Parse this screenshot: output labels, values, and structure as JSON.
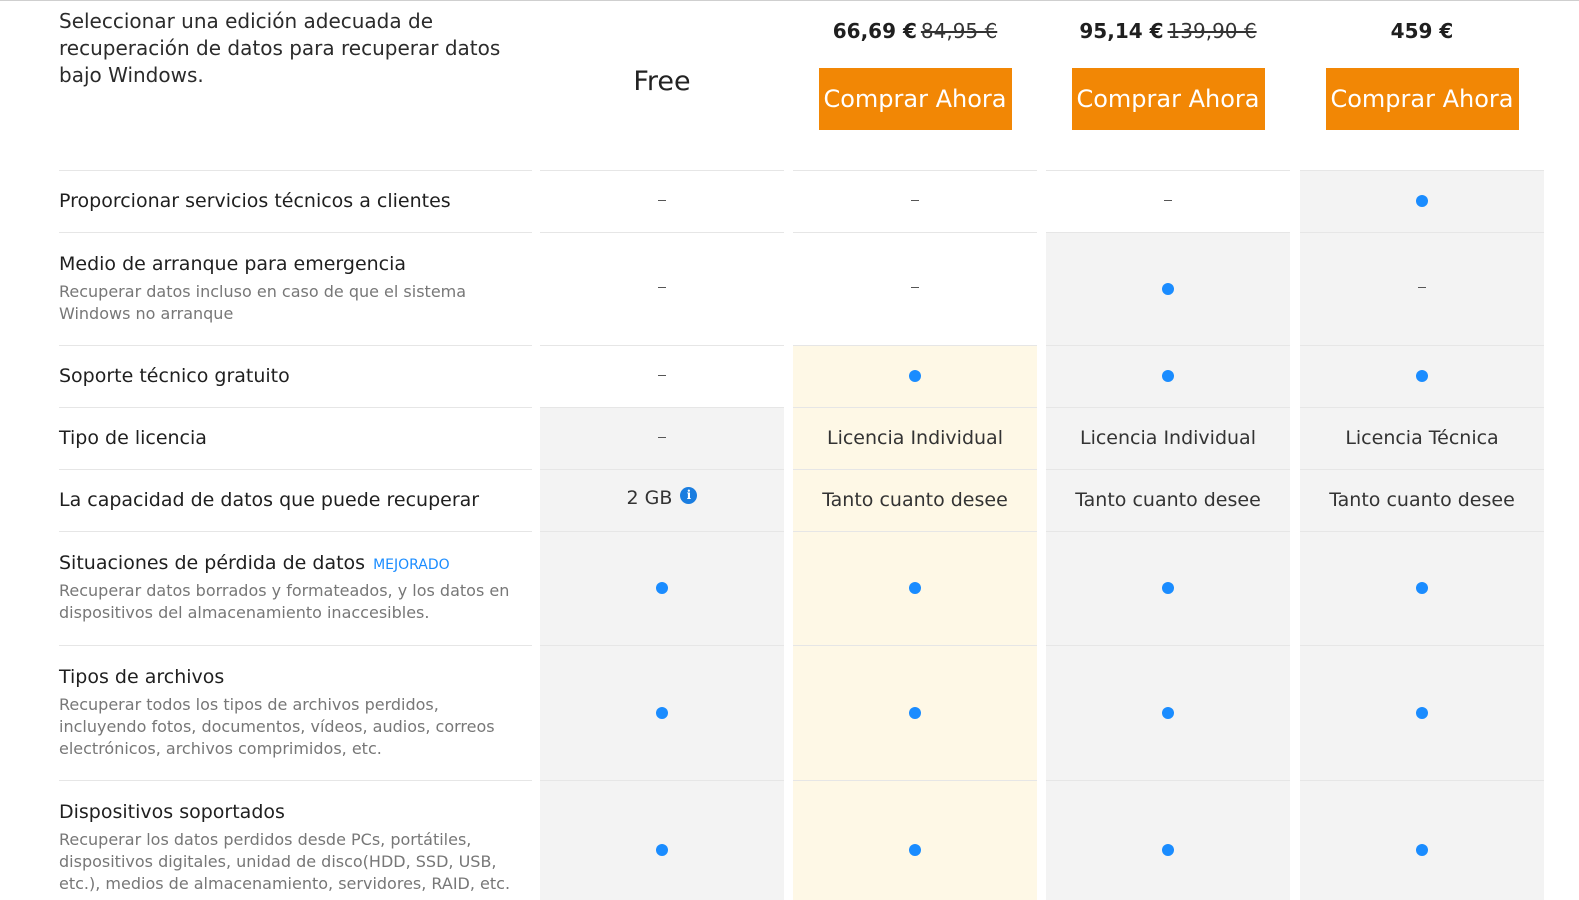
{
  "header": {
    "intro": "Seleccionar una edición adecuada de recuperación de datos para recuperar datos bajo Windows.",
    "free_label": "Free",
    "plans": [
      {
        "price": "66,69 €",
        "old_price": "84,95 €",
        "button": "Comprar Ahora"
      },
      {
        "price": "95,14 €",
        "old_price": "139,90 €",
        "button": "Comprar Ahora"
      },
      {
        "price": "459 €",
        "old_price": "",
        "button": "Comprar Ahora"
      }
    ]
  },
  "colors": {
    "accent_button": "#f28705",
    "dot": "#1a8cff",
    "highlight_column": "#fef8e6",
    "gray_cell": "#f3f3f3"
  },
  "rows": [
    {
      "title": "Proporcionar servicios técnicos a clientes",
      "desc": "",
      "badge": "",
      "cells": [
        {
          "type": "dash"
        },
        {
          "type": "dash"
        },
        {
          "type": "dash"
        },
        {
          "type": "dot"
        }
      ]
    },
    {
      "title": "Medio de arranque para emergencia",
      "desc": "Recuperar datos incluso en caso de que el sistema Windows no arranque",
      "badge": "",
      "cells": [
        {
          "type": "dash"
        },
        {
          "type": "dash"
        },
        {
          "type": "dot"
        },
        {
          "type": "dash"
        }
      ]
    },
    {
      "title": "Soporte técnico gratuito",
      "desc": "",
      "badge": "",
      "cells": [
        {
          "type": "dash"
        },
        {
          "type": "dot"
        },
        {
          "type": "dot"
        },
        {
          "type": "dot"
        }
      ]
    },
    {
      "title": "Tipo de licencia",
      "desc": "",
      "badge": "",
      "cells": [
        {
          "type": "dash"
        },
        {
          "type": "text",
          "text": "Licencia Individual"
        },
        {
          "type": "text",
          "text": "Licencia Individual"
        },
        {
          "type": "text",
          "text": "Licencia Técnica"
        }
      ]
    },
    {
      "title": "La capacidad de datos que puede recuperar",
      "desc": "",
      "badge": "",
      "cells": [
        {
          "type": "text",
          "text": "2 GB",
          "info": "i"
        },
        {
          "type": "text",
          "text": "Tanto cuanto desee"
        },
        {
          "type": "text",
          "text": "Tanto cuanto desee"
        },
        {
          "type": "text",
          "text": "Tanto cuanto desee"
        }
      ]
    },
    {
      "title": "Situaciones de pérdida de datos",
      "desc": "Recuperar datos borrados y formateados, y los datos en dispositivos del almacenamiento inaccesibles.",
      "badge": "MEJORADO",
      "cells": [
        {
          "type": "dot"
        },
        {
          "type": "dot"
        },
        {
          "type": "dot"
        },
        {
          "type": "dot"
        }
      ]
    },
    {
      "title": "Tipos de archivos",
      "desc": "Recuperar todos los tipos de archivos perdidos, incluyendo fotos, documentos, vídeos, audios, correos electrónicos, archivos comprimidos, etc.",
      "badge": "",
      "cells": [
        {
          "type": "dot"
        },
        {
          "type": "dot"
        },
        {
          "type": "dot"
        },
        {
          "type": "dot"
        }
      ]
    },
    {
      "title": "Dispositivos soportados",
      "desc": "Recuperar los datos perdidos desde PCs, portátiles, dispositivos digitales, unidad de disco(HDD, SSD, USB, etc.), medios de almacenamiento, servidores, RAID, etc.",
      "badge": "",
      "cells": [
        {
          "type": "dot"
        },
        {
          "type": "dot"
        },
        {
          "type": "dot"
        },
        {
          "type": "dot"
        }
      ]
    }
  ]
}
